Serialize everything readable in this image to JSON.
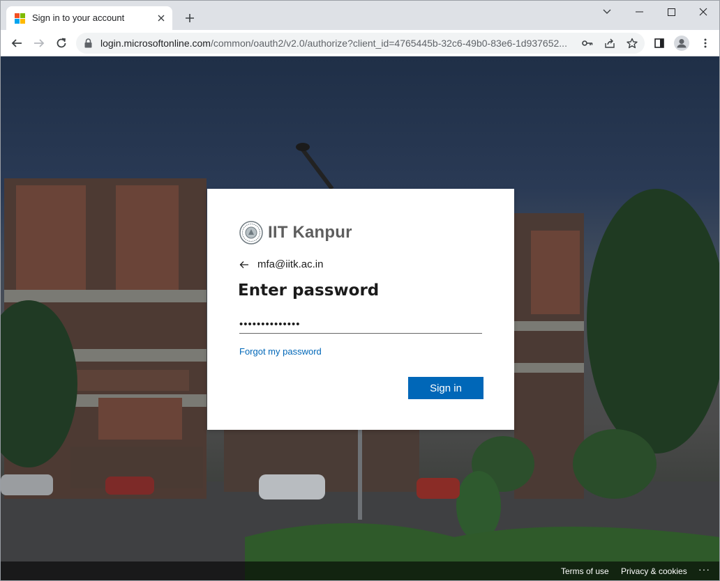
{
  "browser": {
    "tab": {
      "title": "Sign in to your account"
    },
    "address_bar": {
      "host": "login.microsoftonline.com",
      "path": "/common/oauth2/v2.0/authorize?client_id=4765445b-32c6-49b0-83e6-1d937652..."
    }
  },
  "signin": {
    "organization": "IIT Kanpur",
    "username": "mfa@iitk.ac.in",
    "heading": "Enter password",
    "password_value": "••••••••••••••",
    "forgot_link": "Forgot my password",
    "submit_label": "Sign in"
  },
  "footer": {
    "terms": "Terms of use",
    "privacy": "Privacy & cookies",
    "more": "···"
  },
  "colors": {
    "accent": "#0067b8",
    "chrome": "#dee1e6"
  }
}
